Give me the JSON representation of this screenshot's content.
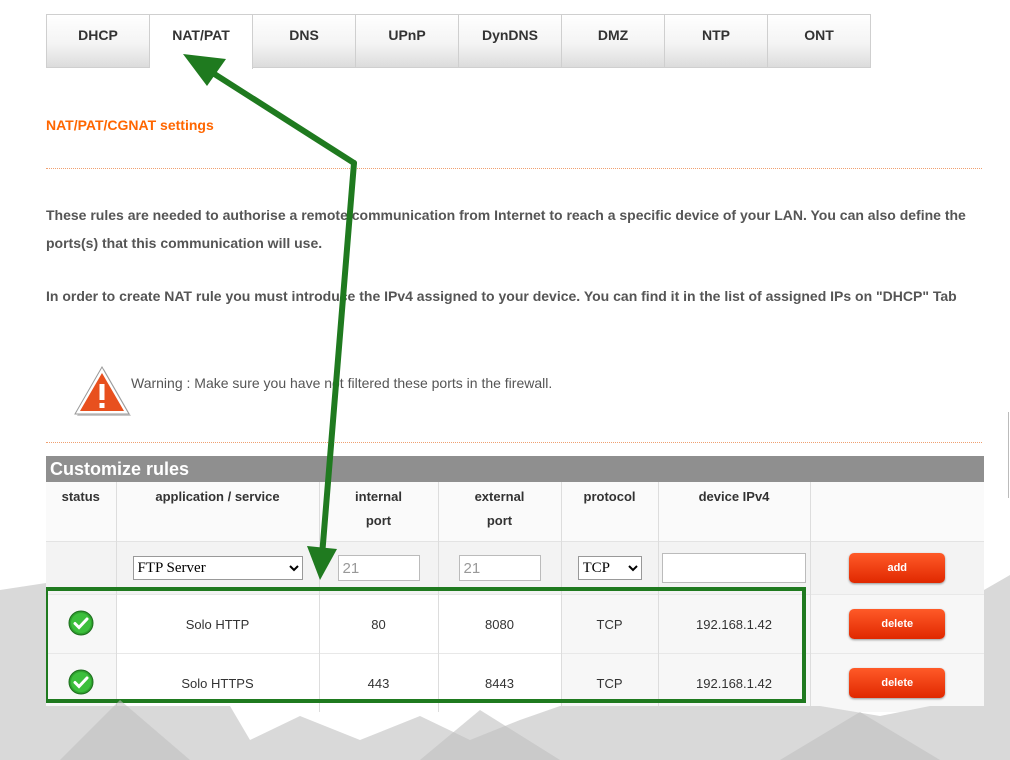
{
  "tabs": [
    "DHCP",
    "NAT/PAT",
    "DNS",
    "UPnP",
    "DynDNS",
    "DMZ",
    "NTP",
    "ONT"
  ],
  "active_tab": "NAT/PAT",
  "section_title": "NAT/PAT/CGNAT settings",
  "intro_1": "These rules are needed to authorise a remote communication from Internet to reach a specific device of your LAN. You can also define the ports(s) that this communication will use.",
  "intro_2": "In order to create NAT rule you must introduce the IPv4 assigned to your device. You can find it in the list of assigned IPs on \"DHCP\" Tab",
  "warning": "Warning : Make sure you have not filtered these ports in the firewall.",
  "rules": {
    "title": "Customize rules",
    "headers": {
      "status": "status",
      "application": "application / service",
      "internal_1": "internal",
      "internal_2": "port",
      "external_1": "external",
      "external_2": "port",
      "protocol": "protocol",
      "device": "device IPv4"
    },
    "new_rule": {
      "application": "FTP Server",
      "internal_port": "21",
      "external_port": "21",
      "protocol": "TCP",
      "device_ip": "",
      "add_label": "add"
    },
    "rows": [
      {
        "application": "Solo HTTP",
        "internal_port": "80",
        "external_port": "8080",
        "protocol": "TCP",
        "device_ip": "192.168.1.42",
        "delete_label": "delete"
      },
      {
        "application": "Solo HTTPS",
        "internal_port": "443",
        "external_port": "8443",
        "protocol": "TCP",
        "device_ip": "192.168.1.42",
        "delete_label": "delete"
      }
    ]
  },
  "colors": {
    "accent": "#ff6600",
    "button": "#e83000",
    "annotation": "#1f7a1f",
    "status_ok": "#2ea12e"
  }
}
